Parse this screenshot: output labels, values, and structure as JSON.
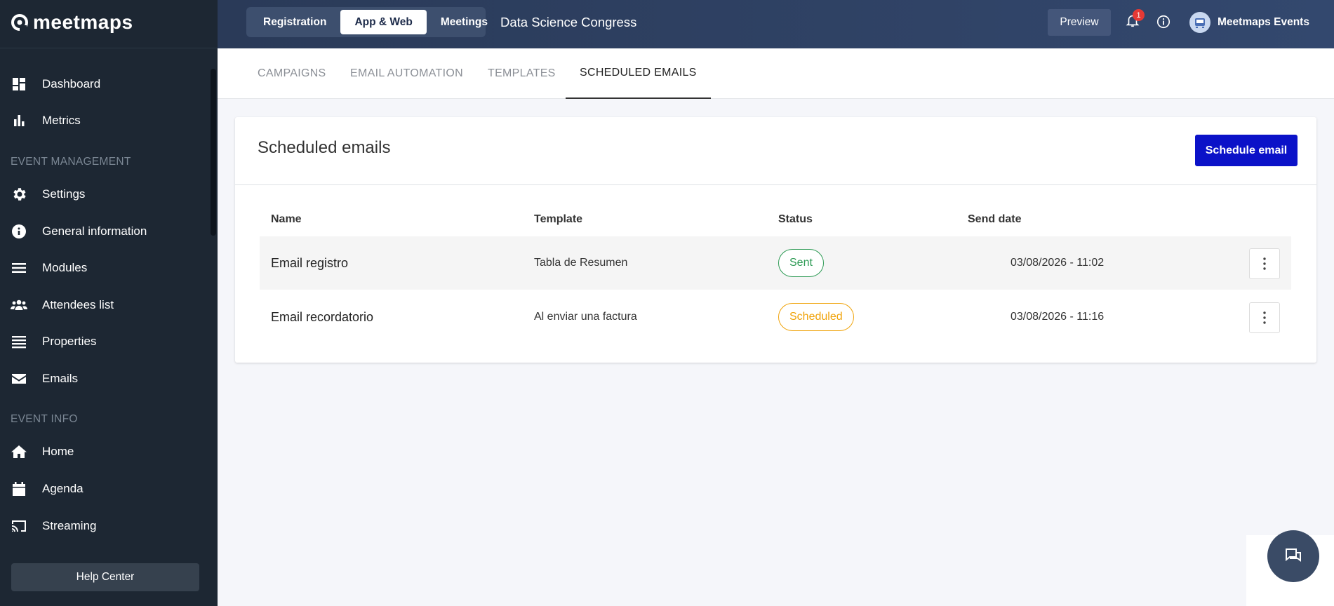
{
  "brand": {
    "logo_text": "meetmaps"
  },
  "sidebar": {
    "items": [
      {
        "label": "Dashboard",
        "icon": "dashboard-icon"
      },
      {
        "label": "Metrics",
        "icon": "bar-chart-icon"
      }
    ],
    "section_event_management": "EVENT MANAGEMENT",
    "management_items": [
      {
        "label": "Settings",
        "icon": "gear-icon"
      },
      {
        "label": "General information",
        "icon": "info-circle-icon"
      },
      {
        "label": "Modules",
        "icon": "menu-icon"
      },
      {
        "label": "Attendees list",
        "icon": "users-icon"
      },
      {
        "label": "Properties",
        "icon": "list-icon"
      },
      {
        "label": "Emails",
        "icon": "envelope-icon"
      }
    ],
    "section_event_info": "EVENT INFO",
    "info_items": [
      {
        "label": "Home",
        "icon": "home-icon"
      },
      {
        "label": "Agenda",
        "icon": "calendar-icon"
      },
      {
        "label": "Streaming",
        "icon": "cast-icon"
      }
    ],
    "help_label": "Help Center"
  },
  "topbar": {
    "segments": [
      "Registration",
      "App & Web",
      "Meetings"
    ],
    "active_segment": "App & Web",
    "event_name": "Data Science Congress",
    "preview_label": "Preview",
    "notification_count": "1",
    "user_name": "Meetmaps Events"
  },
  "tabs": [
    "CAMPAIGNS",
    "EMAIL AUTOMATION",
    "TEMPLATES",
    "SCHEDULED EMAILS"
  ],
  "active_tab": "SCHEDULED EMAILS",
  "card": {
    "title": "Scheduled emails",
    "schedule_button": "Schedule email",
    "columns": [
      "Name",
      "Template",
      "Status",
      "Send date"
    ],
    "rows": [
      {
        "name": "Email registro",
        "template": "Tabla de Resumen",
        "status": "Sent",
        "send_date": "03/08/2026 - 11:02"
      },
      {
        "name": "Email recordatorio",
        "template": "Al enviar una factura",
        "status": "Scheduled",
        "send_date": "03/08/2026 - 11:16"
      }
    ]
  },
  "colors": {
    "sidebar_bg": "#1d2733",
    "primary": "#0b12c8",
    "status_sent": "#2e9b55",
    "status_scheduled": "#f0a30a"
  }
}
